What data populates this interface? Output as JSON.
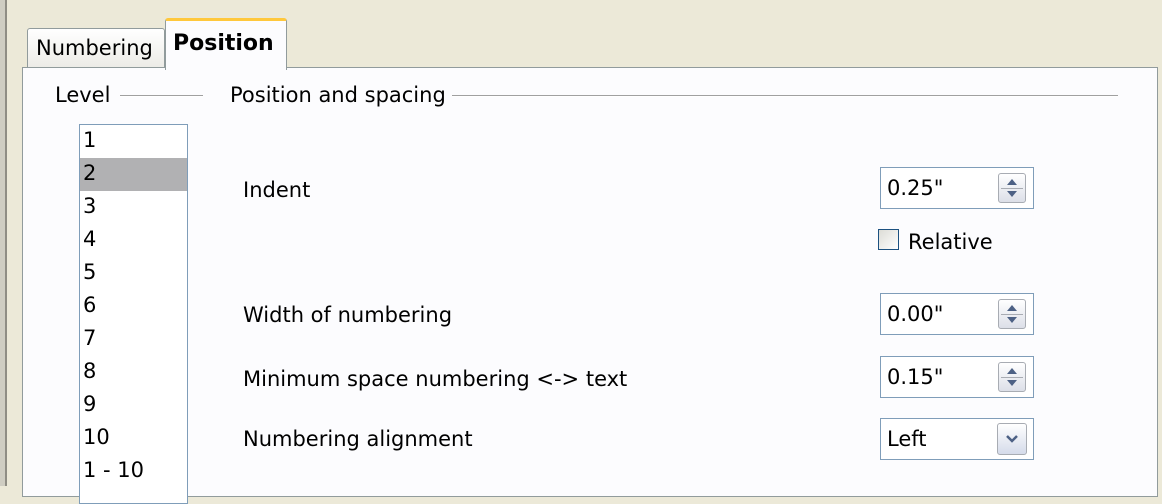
{
  "tabs": [
    {
      "label": "Numbering",
      "active": false
    },
    {
      "label": "Position",
      "active": true
    }
  ],
  "level": {
    "label": "Level",
    "items": [
      "1",
      "2",
      "3",
      "4",
      "5",
      "6",
      "7",
      "8",
      "9",
      "10",
      "1 - 10"
    ],
    "selected": "2"
  },
  "position_spacing": {
    "label": "Position and spacing",
    "indent": {
      "label": "Indent",
      "value": "0.25\""
    },
    "relative": {
      "label": "Relative",
      "checked": false
    },
    "width": {
      "label": "Width of numbering",
      "value": "0.00\""
    },
    "min_space": {
      "label": "Minimum space numbering <-> text",
      "value": "0.15\""
    },
    "alignment": {
      "label": "Numbering alignment",
      "value": "Left"
    }
  }
}
